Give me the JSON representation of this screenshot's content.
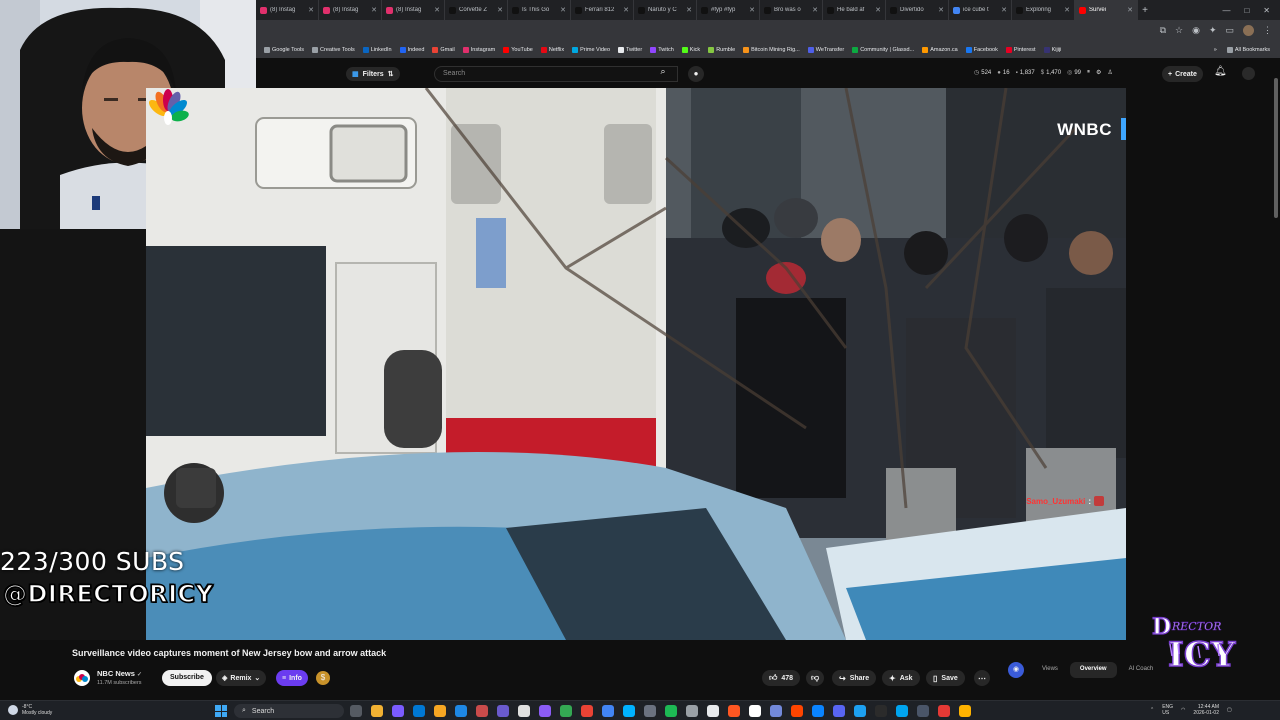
{
  "browser": {
    "tabs": [
      {
        "label": "(8) Instag",
        "color": "#e1306c"
      },
      {
        "label": "(8) Instag",
        "color": "#e1306c"
      },
      {
        "label": "(8) Instag",
        "color": "#e1306c"
      },
      {
        "label": "Corvette Z",
        "color": "#111111"
      },
      {
        "label": "Is This Go",
        "color": "#111111"
      },
      {
        "label": "Ferrari 812",
        "color": "#111111"
      },
      {
        "label": "Naruto y C",
        "color": "#111111"
      },
      {
        "label": "#fyp #fyp",
        "color": "#111111"
      },
      {
        "label": "Bro was o",
        "color": "#111111"
      },
      {
        "label": "He bald af",
        "color": "#111111"
      },
      {
        "label": "Divertido",
        "color": "#111111"
      },
      {
        "label": "ice cube t",
        "color": "#4285f4"
      },
      {
        "label": "Exploring",
        "color": "#111111"
      },
      {
        "label": "Survei",
        "color": "#ff0000",
        "active": true
      }
    ],
    "bookmarks": [
      {
        "label": "Google Tools",
        "color": "#9aa0a6"
      },
      {
        "label": "Creative Tools",
        "color": "#9aa0a6"
      },
      {
        "label": "LinkedIn",
        "color": "#0a66c2"
      },
      {
        "label": "Indeed",
        "color": "#2164f3"
      },
      {
        "label": "Gmail",
        "color": "#ea4335"
      },
      {
        "label": "Instagram",
        "color": "#e1306c"
      },
      {
        "label": "YouTube",
        "color": "#ff0000"
      },
      {
        "label": "Netflix",
        "color": "#e50914"
      },
      {
        "label": "Prime Video",
        "color": "#00a8e1"
      },
      {
        "label": "Twitter",
        "color": "#e8eaed"
      },
      {
        "label": "Twitch",
        "color": "#9146ff"
      },
      {
        "label": "Kick",
        "color": "#53fc18"
      },
      {
        "label": "Rumble",
        "color": "#85c742"
      },
      {
        "label": "Bitcoin Mining Rig...",
        "color": "#f7931a"
      },
      {
        "label": "WeTransfer",
        "color": "#4f5fe8"
      },
      {
        "label": "Community | Glassd...",
        "color": "#0caa41"
      },
      {
        "label": "Amazon.ca",
        "color": "#ff9900"
      },
      {
        "label": "Facebook",
        "color": "#1877f2"
      },
      {
        "label": "Pinterest",
        "color": "#e60023"
      },
      {
        "label": "Kijiji",
        "color": "#373373"
      }
    ],
    "all_bookmarks": "All Bookmarks"
  },
  "youtube": {
    "filters_label": "Filters",
    "search_placeholder": "Search",
    "stats": [
      {
        "icon": "clock-icon",
        "value": "524"
      },
      {
        "icon": "star-icon",
        "value": "16"
      },
      {
        "icon": "chat-icon",
        "value": "1,837"
      },
      {
        "icon": "dollar-icon",
        "value": "1,470"
      },
      {
        "icon": "coin-icon",
        "value": "99"
      }
    ],
    "create_label": "Create"
  },
  "video": {
    "network_label": "WNBC",
    "chat_user": "Samo_Uzumaki",
    "chat_message": ":",
    "title": "Surveillance video captures moment of New Jersey bow and arrow attack"
  },
  "channel": {
    "name": "NBC News",
    "subscribers": "11.7M subscribers",
    "subscribe_label": "Subscribe",
    "remix_label": "Remix",
    "info_label": "Info"
  },
  "actions": {
    "likes": "478",
    "share_label": "Share",
    "ask_label": "Ask",
    "save_label": "Save"
  },
  "side_tabs": {
    "views": "Views",
    "overview": "Overview",
    "ai_coach": "AI Coach"
  },
  "overlay": {
    "subs_counter": "223/300 SUBS",
    "handle": "@DIRECTORICY",
    "logo_text_top": "DRECTOR",
    "logo_text_bottom": "ICY"
  },
  "taskbar": {
    "weather_temp": "-8°C",
    "weather_desc": "Mostly cloudy",
    "search_label": "Search",
    "lang_top": "ENG",
    "lang_bottom": "US",
    "time": "12:44 AM",
    "date": "2026-01-02"
  }
}
